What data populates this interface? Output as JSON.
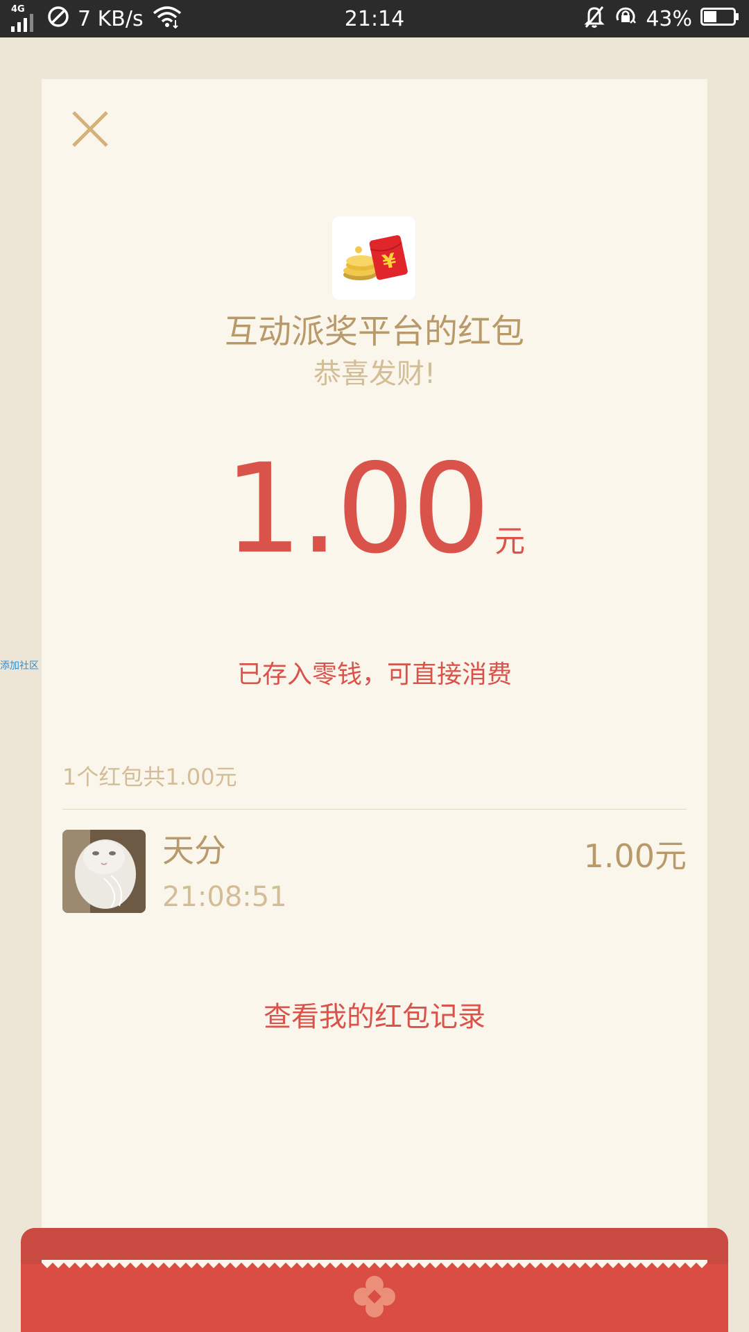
{
  "status_bar": {
    "network_type": "4G",
    "speed": "7 KB/s",
    "time": "21:14",
    "battery_percent": "43%",
    "battery_level": 0.43,
    "icons": [
      "signal-icon",
      "no-disturb-icon",
      "wifi-icon",
      "mute-icon",
      "rotation-lock-icon",
      "battery-icon"
    ]
  },
  "side_link": "添加社区",
  "card": {
    "close_icon": "close-icon",
    "app_icon": "red-envelope-icon",
    "sender_title": "互动派奖平台的红包",
    "greeting": "恭喜发财!",
    "amount": "1.00",
    "amount_unit": "元",
    "amount_note": "已存入零钱，可直接消费",
    "summary": "1个红包共1.00元",
    "records": [
      {
        "name": "天分",
        "time": "21:08:51",
        "amount": "1.00元"
      }
    ],
    "history_link": "查看我的红包记录"
  },
  "colors": {
    "accent_red": "#d9534a",
    "gold_text": "#b89a6a",
    "light_gold_text": "#d3bd97",
    "card_bg": "#faf6ec",
    "page_bg": "#ede5d5",
    "status_bar_bg": "#2b2b2b"
  }
}
